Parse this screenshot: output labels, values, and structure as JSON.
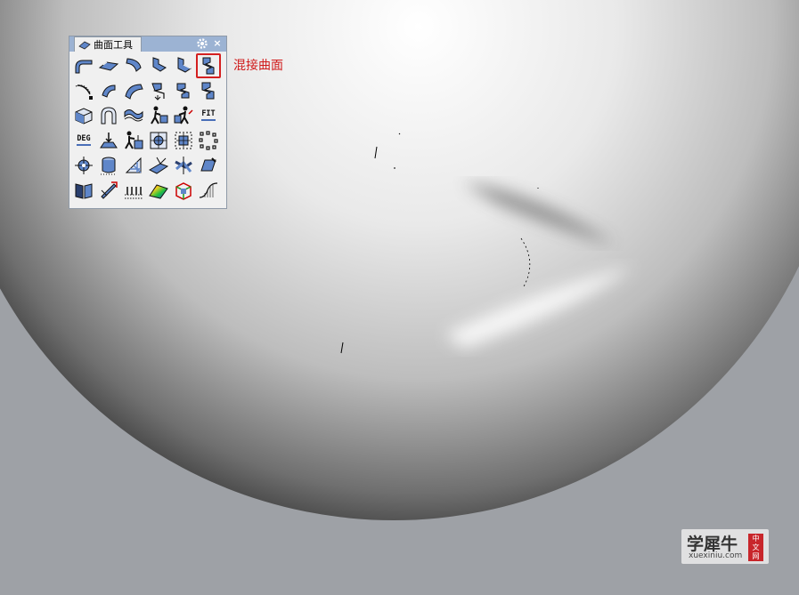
{
  "toolbar": {
    "tab_title": "曲面工具",
    "close_glyph": "×",
    "gear_icon": "gear-icon",
    "tools": [
      {
        "name": "fillet-surface-icon",
        "kind": "fillet"
      },
      {
        "name": "chamfer-surface-icon",
        "kind": "chamfer"
      },
      {
        "name": "variable-fillet-icon",
        "kind": "fillet2"
      },
      {
        "name": "connect-surface-icon",
        "kind": "connect"
      },
      {
        "name": "variable-chamfer-icon",
        "kind": "connect2"
      },
      {
        "name": "blend-surface-icon",
        "kind": "blend",
        "highlight": true
      },
      {
        "name": "offset-surface-icon",
        "kind": "offset"
      },
      {
        "name": "offset-variable-icon",
        "kind": "arc"
      },
      {
        "name": "shell-surface-icon",
        "kind": "arc2"
      },
      {
        "name": "match-surface-icon",
        "kind": "s1"
      },
      {
        "name": "extend-surface-icon",
        "kind": "s2"
      },
      {
        "name": "merge-surface-icon",
        "kind": "s3"
      },
      {
        "name": "box-icon",
        "kind": "box"
      },
      {
        "name": "arch-icon",
        "kind": "arch"
      },
      {
        "name": "wave-icon",
        "kind": "wave"
      },
      {
        "name": "figure-pull-icon",
        "kind": "person"
      },
      {
        "name": "figure-adjust-icon",
        "kind": "person2"
      },
      {
        "name": "fit-icon",
        "kind": "text",
        "label": "FIT"
      },
      {
        "name": "degree-icon",
        "kind": "text",
        "label": "DEG"
      },
      {
        "name": "point-push-icon",
        "kind": "push"
      },
      {
        "name": "figure-push-icon",
        "kind": "person3"
      },
      {
        "name": "target-square-icon",
        "kind": "target"
      },
      {
        "name": "dotted-target-icon",
        "kind": "target2"
      },
      {
        "name": "dotted-circle-icon",
        "kind": "dots"
      },
      {
        "name": "gear-point-icon",
        "kind": "gearpt"
      },
      {
        "name": "cylinder-icon",
        "kind": "cyl"
      },
      {
        "name": "triangle-grid-icon",
        "kind": "tri"
      },
      {
        "name": "plane-intersect-icon",
        "kind": "plane"
      },
      {
        "name": "twist-icon",
        "kind": "twist"
      },
      {
        "name": "surface-edit-icon",
        "kind": "edit"
      },
      {
        "name": "book-icon",
        "kind": "book"
      },
      {
        "name": "dart-icon",
        "kind": "dart"
      },
      {
        "name": "fence-icon",
        "kind": "fence"
      },
      {
        "name": "rainbow-analysis-icon",
        "kind": "rainbow"
      },
      {
        "name": "box-analysis-icon",
        "kind": "box3"
      },
      {
        "name": "curve-graph-icon",
        "kind": "curve"
      }
    ]
  },
  "callout": {
    "label": "混接曲面"
  },
  "watermark": {
    "name": "学犀牛",
    "url": "xuexiniu.com",
    "seal_lines": [
      "中",
      "文",
      "网"
    ]
  }
}
